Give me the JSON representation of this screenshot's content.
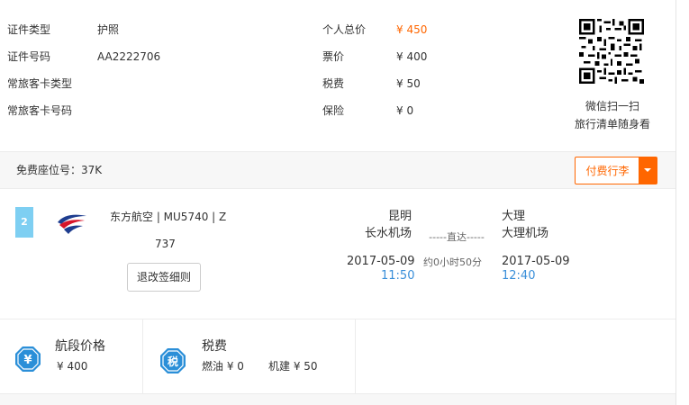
{
  "info": {
    "cert_type_label": "证件类型",
    "cert_type_value": "护照",
    "cert_no_label": "证件号码",
    "cert_no_value": "AA2222706",
    "ffp_type_label": "常旅客卡类型",
    "ffp_no_label": "常旅客卡号码",
    "total_label": "个人总价",
    "total_value": "¥ 450",
    "fare_label": "票价",
    "fare_value": "¥ 400",
    "tax_label": "税费",
    "tax_value": "¥ 50",
    "insurance_label": "保险",
    "insurance_value": "¥ 0"
  },
  "qr": {
    "line1": "微信扫一扫",
    "line2": "旅行清单随身看"
  },
  "seat": {
    "free_seat_text": "免费座位号：37K",
    "paid_baggage_label": "付费行李"
  },
  "flight": {
    "segment_no": "2",
    "airline_text": "东方航空 | MU5740 | Z",
    "aircraft": "737",
    "rules_button": "退改签细则",
    "dep_city": "昆明",
    "dep_airport": "长水机场",
    "dep_date": "2017-05-09",
    "dep_time": "11:50",
    "direct_text": "-----直达-----",
    "duration": "约0小时50分",
    "arr_city": "大理",
    "arr_airport": "大理机场",
    "arr_date": "2017-05-09",
    "arr_time": "12:40"
  },
  "prices": {
    "segment_title": "航段价格",
    "segment_value": "¥ 400",
    "segment_icon_glyph": "¥",
    "tax_title": "税费",
    "tax_icon_glyph": "税",
    "fuel_text": "燃油 ¥ 0",
    "construction_text": "机建 ¥ 50"
  },
  "colors": {
    "accent": "#ff6600",
    "time_blue": "#3a8fd9",
    "badge_blue": "#7ecff2",
    "icon_blue": "#2b8fd8"
  }
}
